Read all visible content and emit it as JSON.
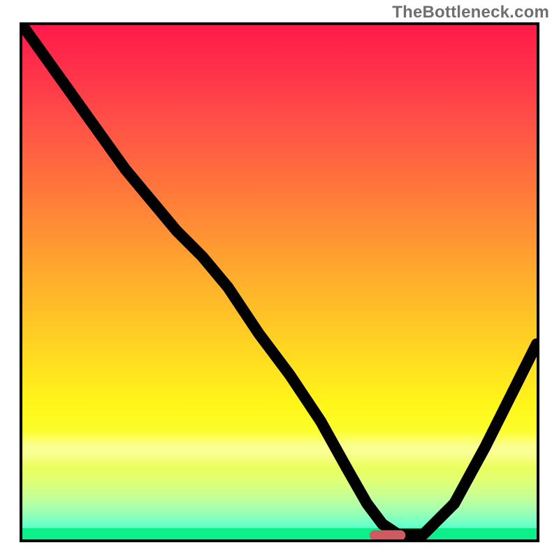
{
  "watermark": {
    "text": "TheBottleneck.com"
  },
  "chart_data": {
    "type": "line",
    "title": "",
    "xlabel": "",
    "ylabel": "",
    "xlim": [
      0,
      100
    ],
    "ylim": [
      0,
      100
    ],
    "grid": false,
    "legend": null,
    "background": {
      "kind": "vertical-gradient",
      "stops": [
        {
          "pos": 0,
          "color": "#ff1a4a"
        },
        {
          "pos": 18,
          "color": "#ff4e48"
        },
        {
          "pos": 38,
          "color": "#ff8a36"
        },
        {
          "pos": 58,
          "color": "#ffc726"
        },
        {
          "pos": 80,
          "color": "#fbff2f"
        },
        {
          "pos": 94,
          "color": "#a8ffad"
        },
        {
          "pos": 100,
          "color": "#14ffb6"
        }
      ],
      "pale_band": {
        "top_pct": 79,
        "height_pct": 7
      },
      "bottom_strip_color": "#0cf08c"
    },
    "series": [
      {
        "name": "bottleneck-curve",
        "color": "#000000",
        "x": [
          0,
          10,
          20,
          30,
          35,
          40,
          46,
          52,
          58,
          63,
          67,
          70,
          73,
          78,
          84,
          90,
          96,
          100
        ],
        "y": [
          100,
          86,
          72,
          60,
          55,
          49,
          40,
          32,
          23,
          14,
          7,
          3,
          1,
          1,
          7,
          18,
          30,
          38
        ]
      }
    ],
    "marker": {
      "name": "optimal-zone",
      "shape": "capsule",
      "color": "#cf5a60",
      "x_center": 71,
      "y_center": 0.8,
      "width": 7,
      "height": 2
    }
  }
}
